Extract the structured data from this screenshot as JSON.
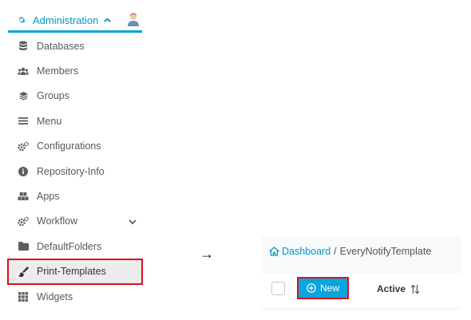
{
  "sidebar": {
    "header_label": "Administration",
    "accent_color": "#00a6d6",
    "items": [
      {
        "label": "Databases",
        "icon": "database-icon"
      },
      {
        "label": "Members",
        "icon": "users-icon"
      },
      {
        "label": "Groups",
        "icon": "layers-icon"
      },
      {
        "label": "Menu",
        "icon": "menu-icon"
      },
      {
        "label": "Configurations",
        "icon": "gears-icon"
      },
      {
        "label": "Repository-Info",
        "icon": "info-icon"
      },
      {
        "label": "Apps",
        "icon": "cubes-icon"
      },
      {
        "label": "Workflow",
        "icon": "gears-icon"
      },
      {
        "label": "DefaultFolders",
        "icon": "folder-icon"
      },
      {
        "label": "Print-Templates",
        "icon": "brush-icon"
      },
      {
        "label": "Widgets",
        "icon": "grid-icon"
      }
    ],
    "active_item": "Print-Templates"
  },
  "arrow": "→",
  "panel": {
    "breadcrumb_link": "Dashboard",
    "breadcrumb_separator": "/",
    "breadcrumb_current": "EveryNotifyTemplate",
    "new_button_label": "New",
    "column_header": "Active",
    "highlight_color": "#e0101a",
    "button_color": "#0aa5dc"
  }
}
